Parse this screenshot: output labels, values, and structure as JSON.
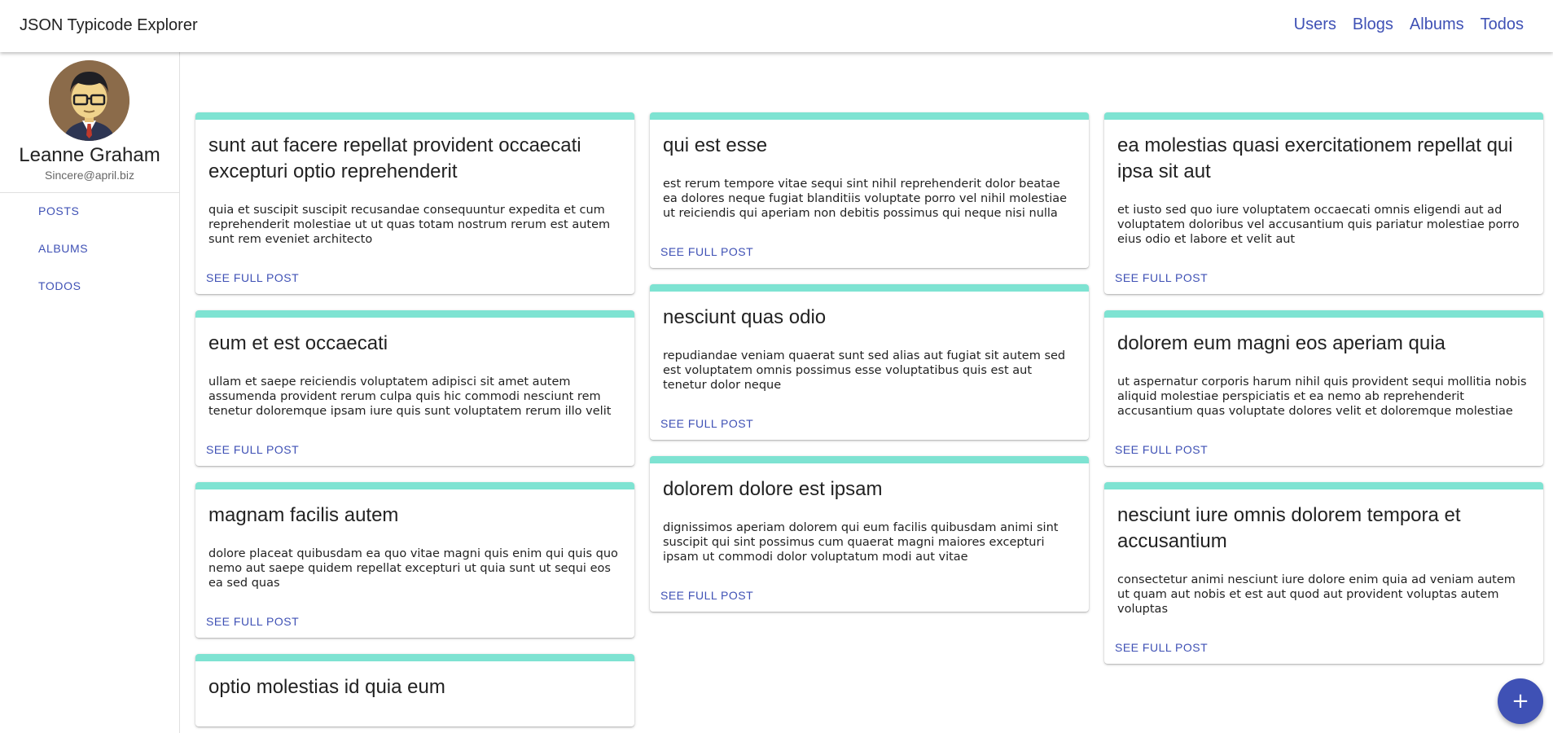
{
  "appbar": {
    "title": "JSON Typicode Explorer",
    "nav": [
      "Users",
      "Blogs",
      "Albums",
      "Todos"
    ]
  },
  "sidebar": {
    "user_name": "Leanne Graham",
    "user_email": "Sincere@april.biz",
    "menu": [
      "POSTS",
      "ALBUMS",
      "TODOS"
    ]
  },
  "card_action_label": "SEE FULL POST",
  "columns": [
    [
      {
        "title": "sunt aut facere repellat provident occaecati excepturi optio reprehenderit",
        "body": "quia et suscipit suscipit recusandae consequuntur expedita et cum reprehenderit molestiae ut ut quas totam nostrum rerum est autem sunt rem eveniet architecto",
        "action": "SEE FULL POST"
      },
      {
        "title": "eum et est occaecati",
        "body": "ullam et saepe reiciendis voluptatem adipisci sit amet autem assumenda provident rerum culpa quis hic commodi nesciunt rem tenetur doloremque ipsam iure quis sunt voluptatem rerum illo velit",
        "action": "SEE FULL POST"
      },
      {
        "title": "magnam facilis autem",
        "body": "dolore placeat quibusdam ea quo vitae magni quis enim qui quis quo nemo aut saepe quidem repellat excepturi ut quia sunt ut sequi eos ea sed quas",
        "action": "SEE FULL POST"
      },
      {
        "title": "optio molestias id quia eum",
        "body": "",
        "action": ""
      }
    ],
    [
      {
        "title": "qui est esse",
        "body": "est rerum tempore vitae sequi sint nihil reprehenderit dolor beatae ea dolores neque fugiat blanditiis voluptate porro vel nihil molestiae ut reiciendis qui aperiam non debitis possimus qui neque nisi nulla",
        "action": "SEE FULL POST"
      },
      {
        "title": "nesciunt quas odio",
        "body": "repudiandae veniam quaerat sunt sed alias aut fugiat sit autem sed est voluptatem omnis possimus esse voluptatibus quis est aut tenetur dolor neque",
        "action": "SEE FULL POST"
      },
      {
        "title": "dolorem dolore est ipsam",
        "body": "dignissimos aperiam dolorem qui eum facilis quibusdam animi sint suscipit qui sint possimus cum quaerat magni maiores excepturi ipsam ut commodi dolor voluptatum modi aut vitae",
        "action": "SEE FULL POST"
      }
    ],
    [
      {
        "title": "ea molestias quasi exercitationem repellat qui ipsa sit aut",
        "body": "et iusto sed quo iure voluptatem occaecati omnis eligendi aut ad voluptatem doloribus vel accusantium quis pariatur molestiae porro eius odio et labore et velit aut",
        "action": "SEE FULL POST"
      },
      {
        "title": "dolorem eum magni eos aperiam quia",
        "body": "ut aspernatur corporis harum nihil quis provident sequi mollitia nobis aliquid molestiae perspiciatis et ea nemo ab reprehenderit accusantium quas voluptate dolores velit et doloremque molestiae",
        "action": "SEE FULL POST"
      },
      {
        "title": "nesciunt iure omnis dolorem tempora et accusantium",
        "body": "consectetur animi nesciunt iure dolore enim quia ad veniam autem ut quam aut nobis et est aut quod aut provident voluptas autem voluptas",
        "action": "SEE FULL POST"
      }
    ]
  ],
  "fab": {
    "icon": "plus-icon",
    "symbol": "+"
  },
  "colors": {
    "primary": "#3f51b5",
    "card_accent": "#7ee3d2"
  }
}
